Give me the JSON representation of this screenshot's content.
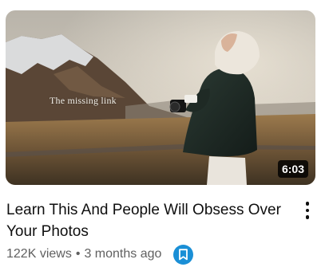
{
  "video": {
    "thumbnail_overlay_text": "The missing link",
    "duration": "6:03",
    "title": "Learn This And People Will Obsess Over Your Photos",
    "views": "122K views",
    "separator": "•",
    "age": "3 months ago"
  },
  "icons": {
    "menu": "more-vert-icon",
    "save": "bookmark-icon"
  },
  "colors": {
    "save_button": "#1a8fd6",
    "meta_text": "#606060",
    "title_text": "#0f0f0f"
  }
}
